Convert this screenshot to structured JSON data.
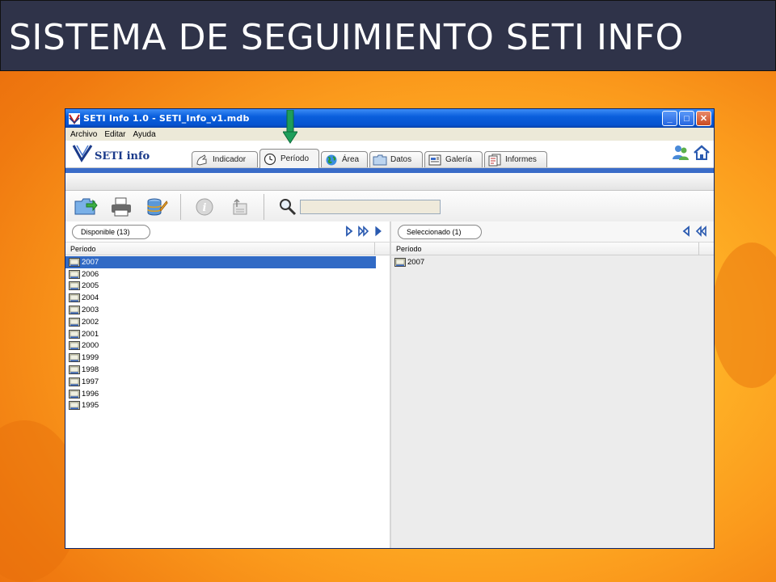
{
  "slide": {
    "title": "SISTEMA DE SEGUIMIENTO SETI INFO"
  },
  "window": {
    "title": "SETI Info 1.0 - SETI_Info_v1.mdb",
    "controls": {
      "minimize": "_",
      "maximize": "□",
      "close": "✕"
    }
  },
  "menu": [
    "Archivo",
    "Editar",
    "Ayuda"
  ],
  "logo": {
    "text": "SETI info"
  },
  "tabs": [
    {
      "label": "Indicador",
      "icon": "hand-icon",
      "active": false
    },
    {
      "label": "Período",
      "icon": "clock-icon",
      "active": true
    },
    {
      "label": "Área",
      "icon": "globe-icon",
      "active": false
    },
    {
      "label": "Datos",
      "icon": "folder-icon",
      "active": false
    },
    {
      "label": "Galería",
      "icon": "gallery-icon",
      "active": false
    },
    {
      "label": "Informes",
      "icon": "reports-icon",
      "active": false
    }
  ],
  "toolbar": {
    "buttons": [
      "open-folder-icon",
      "print-icon",
      "database-edit-icon",
      "info-icon",
      "export-icon",
      "search-icon"
    ],
    "search_value": ""
  },
  "available": {
    "label": "Disponible (13)",
    "column": "Período",
    "items": [
      "2007",
      "2006",
      "2005",
      "2004",
      "2003",
      "2002",
      "2001",
      "2000",
      "1999",
      "1998",
      "1997",
      "1996",
      "1995"
    ],
    "selected_item": "2007"
  },
  "selected": {
    "label": "Seleccionado (1)",
    "column": "Período",
    "items": [
      "2007"
    ]
  },
  "colors": {
    "header_bg": "#2f3349",
    "titlebar": "#0a5fdc",
    "selection": "#316ac5",
    "marker": "#1e9e5a"
  }
}
